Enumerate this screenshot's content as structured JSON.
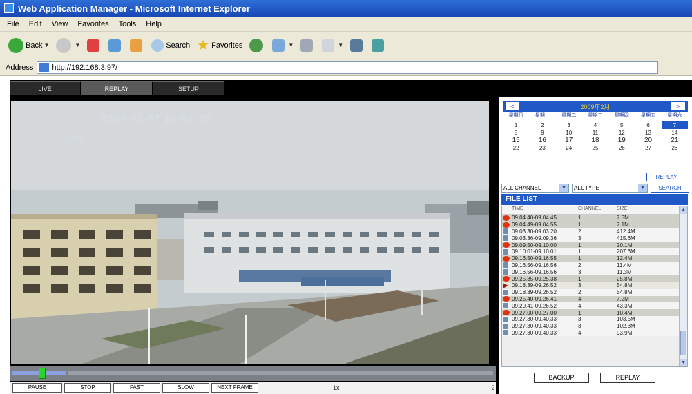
{
  "window": {
    "title": "Web Application Manager - Microsoft Internet Explorer"
  },
  "menu": [
    "File",
    "Edit",
    "View",
    "Favorites",
    "Tools",
    "Help"
  ],
  "toolbar": {
    "back_label": "Back",
    "search_label": "Search",
    "favorites_label": "Favorites"
  },
  "address": {
    "label": "Address",
    "url": "http://192.168.3.97/"
  },
  "tabs": [
    {
      "label": "LIVE"
    },
    {
      "label": "REPLAY"
    },
    {
      "label": "SETUP"
    }
  ],
  "video": {
    "osd_time": "2009-02-07  10:01:33",
    "osd_camera": "CH3",
    "progress": 0.06
  },
  "controls": {
    "buttons": [
      "PAUSE",
      "STOP",
      "FAST",
      "SLOW",
      "NEXT FRAME"
    ],
    "speed": "1x",
    "frame": "2"
  },
  "calendar": {
    "month_label": "2009年2月",
    "prev": "<",
    "next": ">",
    "weekdays": [
      "星期日",
      "星期一",
      "星期二",
      "星期三",
      "星期四",
      "星期五",
      "星期六"
    ],
    "weeks": [
      [
        "1",
        "2",
        "3",
        "4",
        "5",
        "6",
        "7"
      ],
      [
        "8",
        "9",
        "10",
        "11",
        "12",
        "13",
        "14"
      ],
      [
        "15",
        "16",
        "17",
        "18",
        "19",
        "20",
        "21"
      ],
      [
        "22",
        "23",
        "24",
        "25",
        "26",
        "27",
        "28"
      ]
    ],
    "selected_day": "7"
  },
  "replay_top_label": "REPLAY",
  "filters": {
    "channel": "ALL CHANNEL",
    "type": "ALL TYPE",
    "search_label": "SEARCH"
  },
  "list": {
    "header": "FILE LIST",
    "columns": [
      "TIME",
      "CHANNEL",
      "SIZE"
    ],
    "records": [
      {
        "type": "alarm",
        "time": "09.04.40-09.04.45",
        "channel": "1",
        "size": "7.5M",
        "row": "gray"
      },
      {
        "type": "alarm",
        "time": "09.04.49-09.04.55",
        "channel": "1",
        "size": "7.1M",
        "row": "gray"
      },
      {
        "type": "manual",
        "time": "09.03.30-09.03.20",
        "channel": "2",
        "size": "412.4M",
        "row": "white"
      },
      {
        "type": "manual",
        "time": "09.03.36-09.09.36",
        "channel": "3",
        "size": "415.6M",
        "row": "white"
      },
      {
        "type": "alarm",
        "time": "09.09.50-09.10.00",
        "channel": "1",
        "size": "20.1M",
        "row": "gray"
      },
      {
        "type": "manual",
        "time": "09.10.01-09.10.01",
        "channel": "1",
        "size": "207.6M",
        "row": "white"
      },
      {
        "type": "alarm",
        "time": "09.16.50-09.16.55",
        "channel": "1",
        "size": "12.4M",
        "row": "gray"
      },
      {
        "type": "manual",
        "time": "09.16.56-09.16.56",
        "channel": "2",
        "size": "11.4M",
        "row": "white"
      },
      {
        "type": "manual",
        "time": "09.16.56-09.16.56",
        "channel": "3",
        "size": "11.3M",
        "row": "white"
      },
      {
        "type": "alarm",
        "time": "09.25.35-09.25.38",
        "channel": "1",
        "size": "25.8M",
        "row": "gray"
      },
      {
        "type": "play",
        "time": "09.18.39-09.26.52",
        "channel": "3",
        "size": "54.8M",
        "row": "sel"
      },
      {
        "type": "manual",
        "time": "09.18.39-09.26.52",
        "channel": "2",
        "size": "54.8M",
        "row": "white"
      },
      {
        "type": "alarm",
        "time": "09.25.40-09.26.41",
        "channel": "4",
        "size": "7.2M",
        "row": "gray"
      },
      {
        "type": "manual",
        "time": "09.20.41-09.26.52",
        "channel": "4",
        "size": "43.3M",
        "row": "white"
      },
      {
        "type": "alarm",
        "time": "09.27.00-09.27.00",
        "channel": "1",
        "size": "10.4M",
        "row": "gray"
      },
      {
        "type": "manual",
        "time": "09.27.30-09.40.33",
        "channel": "3",
        "size": "103.5M",
        "row": "white"
      },
      {
        "type": "manual",
        "time": "09.27.30-09.40.33",
        "channel": "3",
        "size": "102.3M",
        "row": "white"
      },
      {
        "type": "manual",
        "time": "09.27.30-09.40.33",
        "channel": "4",
        "size": "93.9M",
        "row": "white"
      }
    ]
  },
  "bottom_buttons": {
    "backup": "BACKUP",
    "replay": "REPLAY"
  },
  "colors": {
    "accent": "#2058c8",
    "titlebar": "#1848b5",
    "alarm": "#e03010",
    "progress_thumb": "#2ad62a"
  }
}
